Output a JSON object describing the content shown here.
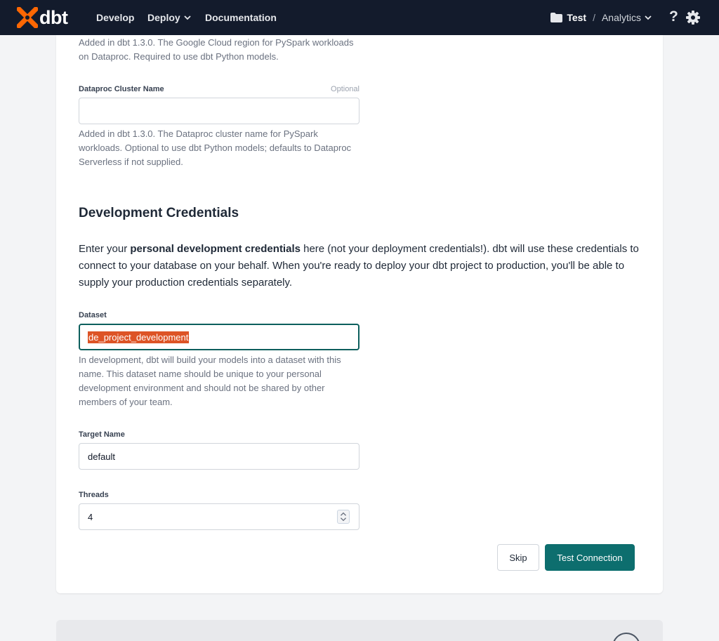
{
  "nav": {
    "brand": "dbt",
    "develop": "Develop",
    "deploy": "Deploy",
    "documentation": "Documentation",
    "project": "Test",
    "separator": "/",
    "environment": "Analytics",
    "help": "?"
  },
  "form": {
    "region_help": "Added in dbt 1.3.0. The Google Cloud region for PySpark workloads on Dataproc. Required to use dbt Python models.",
    "cluster_label": "Dataproc Cluster Name",
    "cluster_optional": "Optional",
    "cluster_value": "",
    "cluster_help": "Added in dbt 1.3.0. The Dataproc cluster name for PySpark workloads. Optional to use dbt Python models; defaults to Dataproc Serverless if not supplied.",
    "section_title": "Development Credentials",
    "intro_pre": "Enter your ",
    "intro_bold": "personal development credentials",
    "intro_post": " here (not your deployment credentials!). dbt will use these credentials to connect to your database on your behalf. When you're ready to deploy your dbt project to production, you'll be able to supply your production credentials separately.",
    "dataset_label": "Dataset",
    "dataset_value": "de_project_development",
    "dataset_help": "In development, dbt will build your models into a dataset with this name. This dataset name should be unique to your personal development environment and should not be shared by other members of your team.",
    "target_label": "Target Name",
    "target_value": "default",
    "threads_label": "Threads",
    "threads_value": "4"
  },
  "actions": {
    "skip": "Skip",
    "test_connection": "Test Connection"
  },
  "colors": {
    "nav_bg": "#131b2c",
    "brand_orange": "#fe6703",
    "primary": "#0d6e6e",
    "selection": "#dd5426"
  }
}
